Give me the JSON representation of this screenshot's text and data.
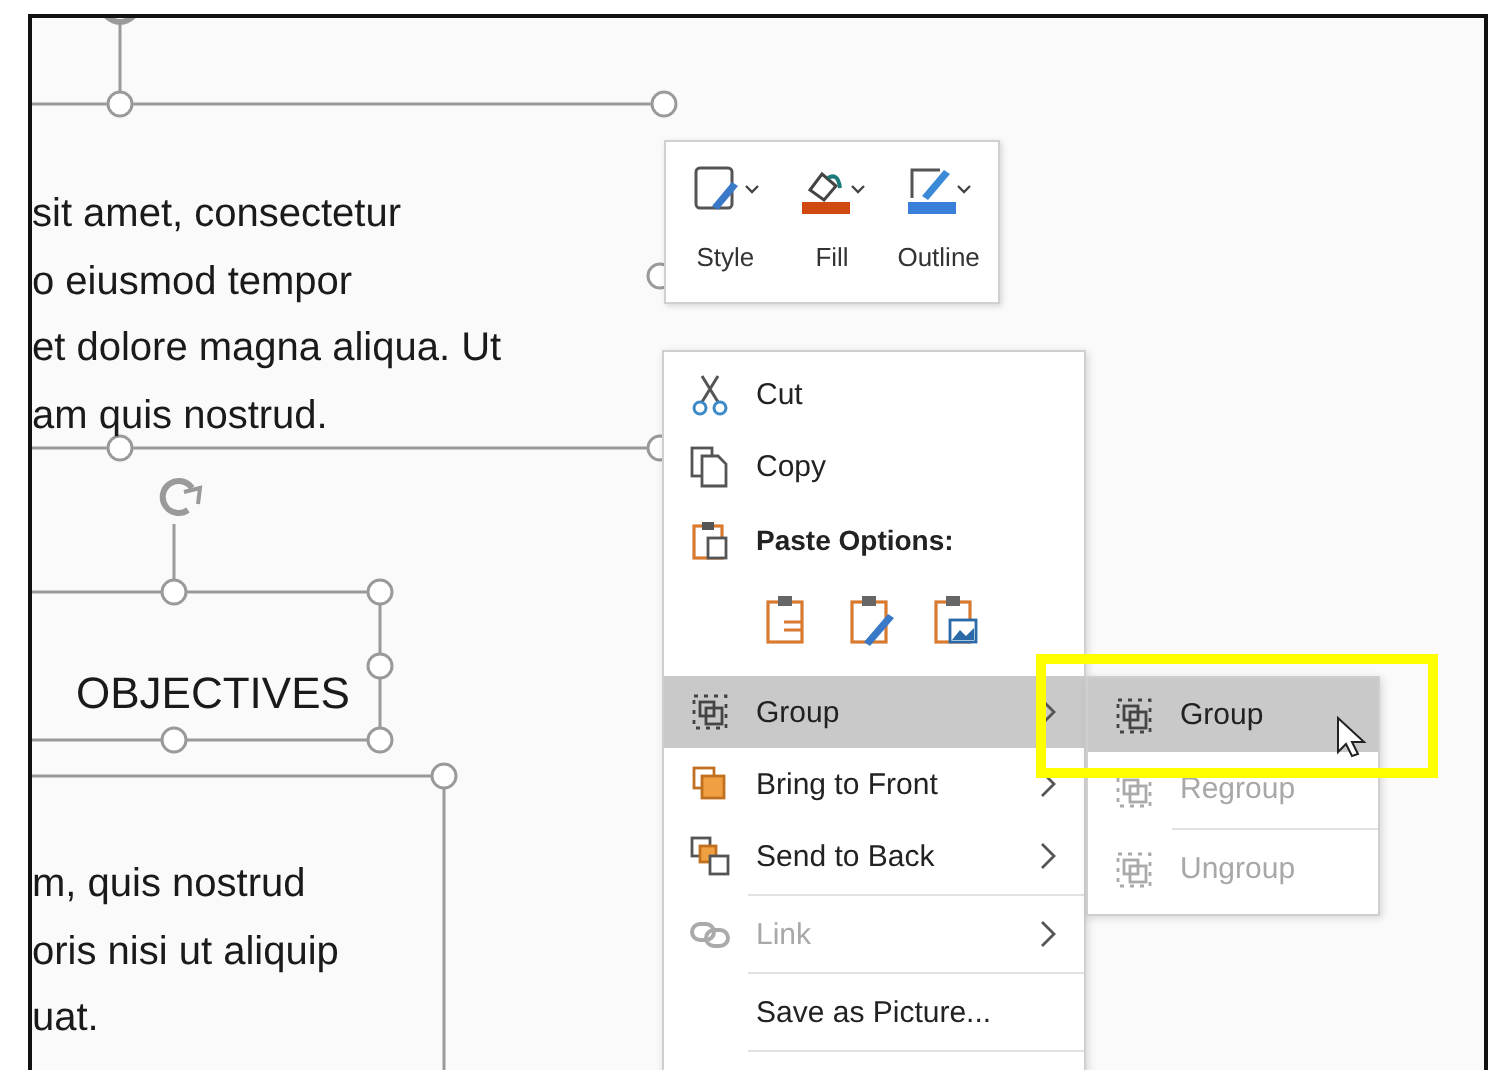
{
  "slide": {
    "top_text_box": {
      "lines": [
        "sit amet, consectetur",
        "o eiusmod tempor",
        "et dolore magna aliqua. Ut",
        "am quis nostrud."
      ]
    },
    "title_box": {
      "text": "OBJECTIVES"
    },
    "bottom_text_box": {
      "lines": [
        "m, quis nostrud",
        "oris nisi ut aliquip",
        "uat."
      ]
    }
  },
  "mini_toolbar": {
    "buttons": [
      {
        "label": "Style",
        "kind": "style"
      },
      {
        "label": "Fill",
        "kind": "fill"
      },
      {
        "label": "Outline",
        "kind": "outline"
      }
    ]
  },
  "context_menu": {
    "items": [
      {
        "kind": "item",
        "label": "Cut",
        "selected": false,
        "disabled": false,
        "submenu": false
      },
      {
        "kind": "item",
        "label": "Copy",
        "selected": false,
        "disabled": false,
        "submenu": false
      },
      {
        "kind": "heading",
        "label": "Paste Options:"
      },
      {
        "kind": "paste_row"
      },
      {
        "kind": "item",
        "label": "Group",
        "selected": true,
        "disabled": false,
        "submenu": true
      },
      {
        "kind": "item",
        "label": "Bring to Front",
        "selected": false,
        "disabled": false,
        "submenu": true
      },
      {
        "kind": "item",
        "label": "Send to Back",
        "selected": false,
        "disabled": false,
        "submenu": true
      },
      {
        "kind": "item",
        "label": "Link",
        "selected": false,
        "disabled": true,
        "submenu": true
      },
      {
        "kind": "item",
        "label": "Save as Picture...",
        "selected": false,
        "disabled": false,
        "submenu": false
      }
    ]
  },
  "submenu": {
    "items": [
      {
        "label": "Group",
        "selected": true,
        "disabled": false
      },
      {
        "label": "Regroup",
        "selected": false,
        "disabled": true
      },
      {
        "label": "Ungroup",
        "selected": false,
        "disabled": true
      }
    ]
  }
}
